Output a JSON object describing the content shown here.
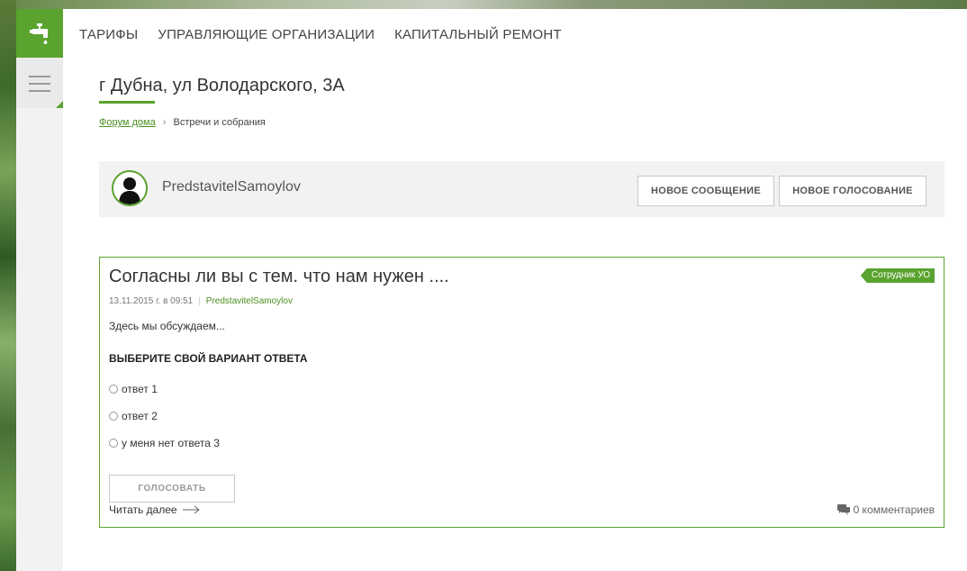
{
  "colors": {
    "accent": "#5aa32e",
    "link": "#4a8f1f",
    "panel": "#f2f2f2"
  },
  "sidebar": {
    "logo_icon": "faucet-icon",
    "menu_icon": "hamburger-icon"
  },
  "nav": {
    "items": [
      {
        "label": "ТАРИФЫ"
      },
      {
        "label": "УПРАВЛЯЮЩИЕ ОРГАНИЗАЦИИ"
      },
      {
        "label": "КАПИТАЛЬНЫЙ РЕМОНТ"
      }
    ]
  },
  "page": {
    "title": "г Дубна, ул Володарского, 3А",
    "breadcrumb": {
      "root": "Форум дома",
      "separator": "›",
      "current": "Встречи и собрания"
    }
  },
  "userbar": {
    "username": "PredstavitelSamoylov",
    "new_message": "НОВОЕ СООБЩЕНИЕ",
    "new_vote": "НОВОЕ ГОЛОСОВАНИЕ"
  },
  "post": {
    "title": "Согласны ли вы с тем. что нам нужен ....",
    "badge": "Сотрудник УО",
    "date": "13.11.2015 г. в 09:51",
    "author": "PredstavitelSamoylov",
    "excerpt": "Здесь мы обсуждаем...",
    "question": "ВЫБЕРИТЕ СВОЙ ВАРИАНТ ОТВЕТА",
    "options": [
      {
        "label": "ответ 1"
      },
      {
        "label": "ответ 2"
      },
      {
        "label": "у меня нет ответа 3"
      }
    ],
    "vote_label": "ГОЛОСОВАТЬ",
    "read_more": "Читать далее",
    "comments": "0 комментариев"
  }
}
